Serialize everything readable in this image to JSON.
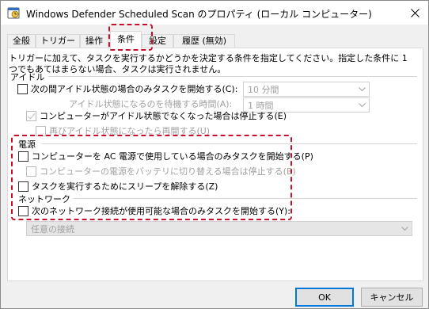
{
  "window": {
    "title": "Windows Defender Scheduled Scan のプロパティ (ローカル コンピューター)"
  },
  "tabs": [
    {
      "label": "全般"
    },
    {
      "label": "トリガー"
    },
    {
      "label": "操作"
    },
    {
      "label": "条件"
    },
    {
      "label": "設定"
    },
    {
      "label": "履歴 (無効)"
    }
  ],
  "active_tab": "条件",
  "description": "トリガーに加えて、タスクを実行するかどうかを決定する条件を指定してください。指定した条件に 1 つでもあてはまらない場合、タスクは実行されません。",
  "idle": {
    "section_label": "アイドル",
    "start_only_if_idle": {
      "label": "次の間アイドル状態の場合のみタスクを開始する(C):",
      "checked": false
    },
    "idle_duration": {
      "value": "10 分間"
    },
    "wait_label": "アイドル状態になるのを待機する時間(A):",
    "wait_duration": {
      "value": "1 時間"
    },
    "stop_if_not_idle": {
      "label": "コンピューターがアイドル状態でなくなった場合は停止する(E)",
      "checked": true
    },
    "restart_if_idle": {
      "label": "再びアイドル状態になったら再開する(U)",
      "checked": false
    }
  },
  "power": {
    "section_label": "電源",
    "ac_only": {
      "label": "コンピューターを AC 電源で使用している場合のみタスクを開始する(P)",
      "checked": false
    },
    "stop_on_battery": {
      "label": "コンピューターの電源をバッテリに切り替える場合は停止する(B)",
      "checked": false
    },
    "wake_to_run": {
      "label": "タスクを実行するためにスリープを解除する(Z)",
      "checked": false
    }
  },
  "network": {
    "section_label": "ネットワーク",
    "network_only": {
      "label": "次のネットワーク接続が使用可能な場合のみタスクを開始する(Y):",
      "checked": false
    },
    "connection": {
      "value": "任意の接続"
    }
  },
  "buttons": {
    "ok": "OK",
    "cancel": "キャンセル"
  },
  "colors": {
    "highlight": "#c8102e",
    "window_bg": "#f0f0f0",
    "disabled_text": "#a0a0a0"
  }
}
